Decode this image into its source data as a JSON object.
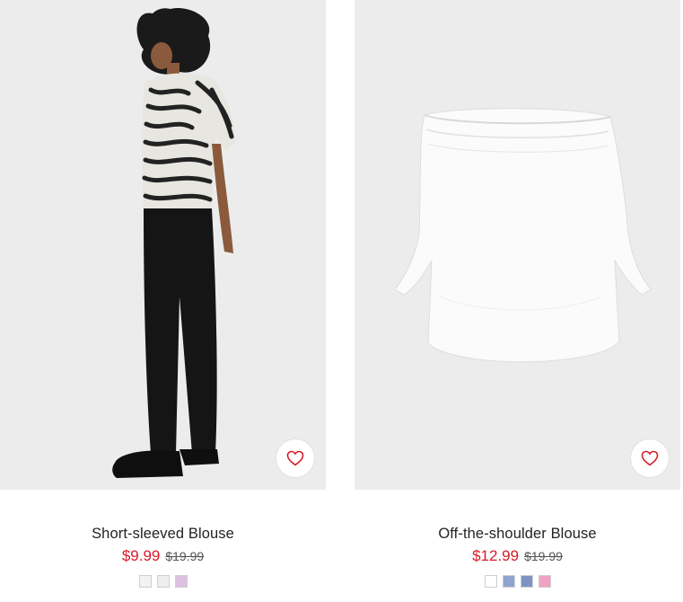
{
  "products": [
    {
      "title": "Short-sleeved Blouse",
      "sale_price": "$9.99",
      "original_price": "$19.99",
      "image_icon": "model-zebra-blouse-photo",
      "swatch_colors": [
        "#f2f2f2",
        "#ededed",
        "#dcc1e0"
      ],
      "favorite_icon": "heart-icon"
    },
    {
      "title": "Off-the-shoulder Blouse",
      "sale_price": "$12.99",
      "original_price": "$19.99",
      "image_icon": "white-blouse-photo",
      "swatch_colors": [
        "#ffffff",
        "#90a4d2",
        "#7f93c3",
        "#f2a1c4"
      ],
      "favorite_icon": "heart-icon"
    }
  ],
  "colors": {
    "sale": "#d81b2a",
    "image_background": "#ececec"
  }
}
